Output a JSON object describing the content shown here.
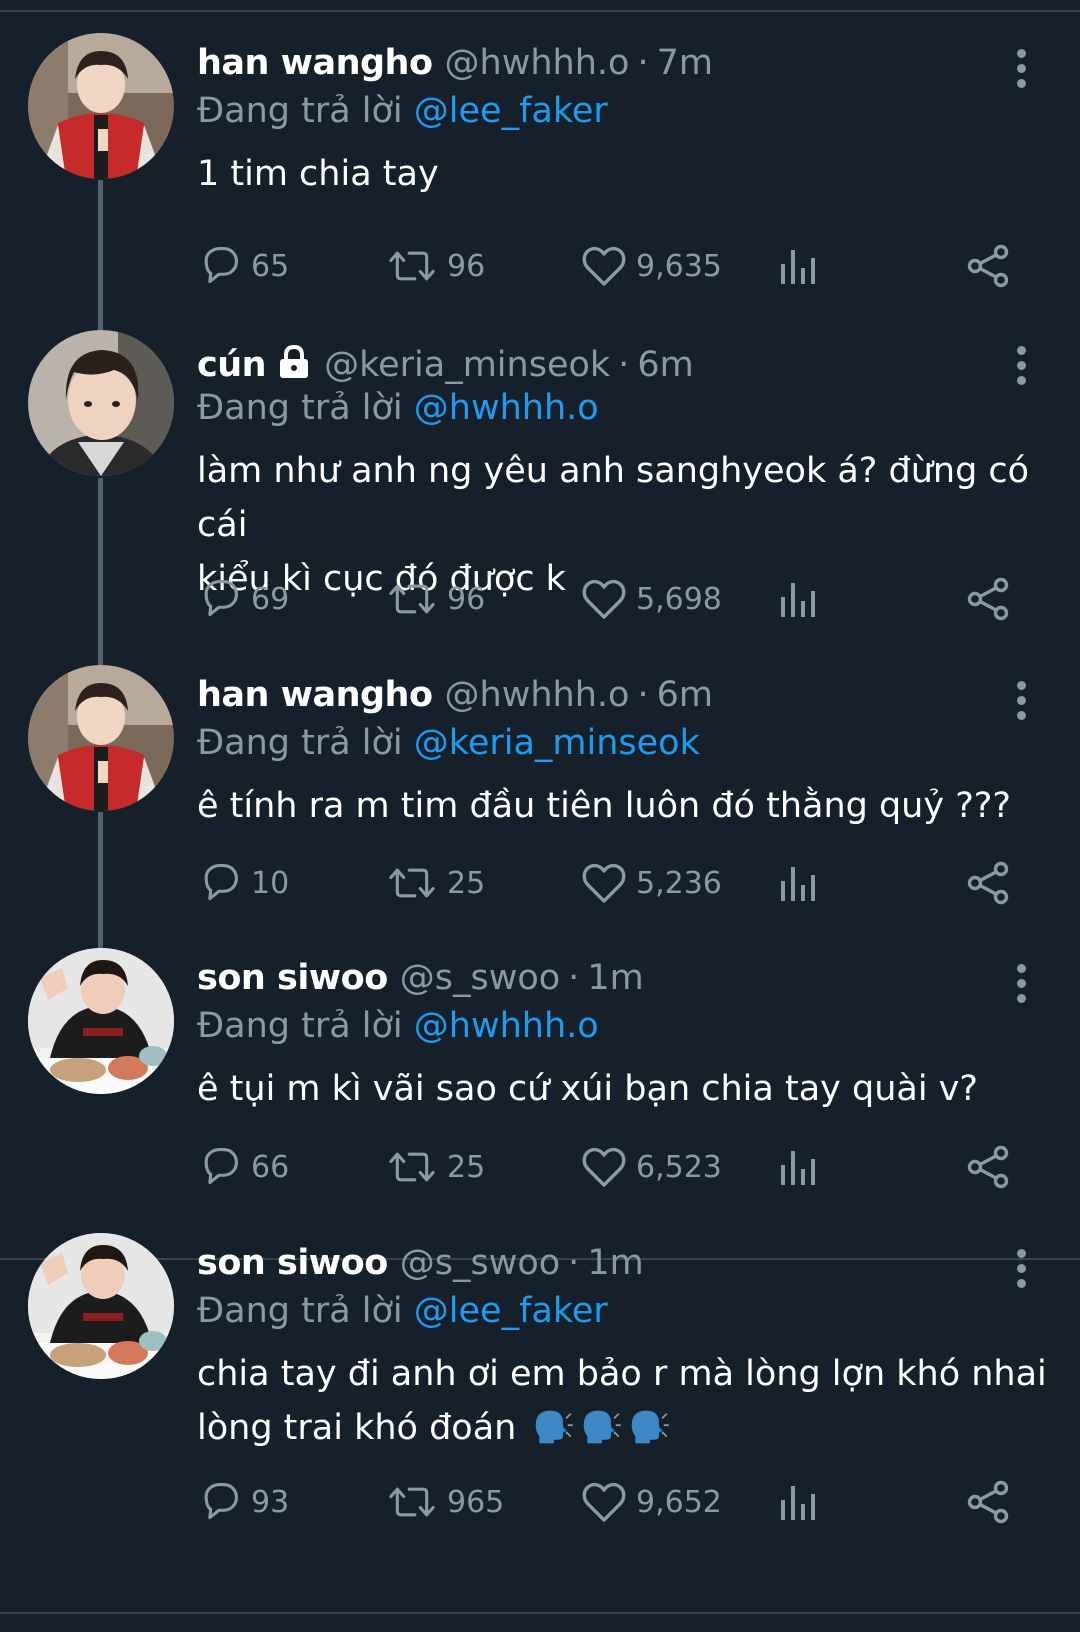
{
  "tweets": [
    {
      "name": "han wangho",
      "handle": "@hwhhh.o",
      "time": "7m",
      "reply_prefix": "Đang trả lời",
      "reply_to": "@lee_faker",
      "text": "1 tim chia tay",
      "replies": "65",
      "retweets": "96",
      "likes": "9,635"
    },
    {
      "name": "cún",
      "locked": true,
      "handle": "@keria_minseok",
      "time": "6m",
      "reply_prefix": "Đang trả lời",
      "reply_to": "@hwhhh.o",
      "text_line1": "làm như anh ng yêu anh sanghyeok á? đừng có cái",
      "text_line2": "kiểu kì cục đó được k",
      "replies": "69",
      "retweets": "96",
      "likes": "5,698"
    },
    {
      "name": "han wangho",
      "handle": "@hwhhh.o",
      "time": "6m",
      "reply_prefix": "Đang trả lời",
      "reply_to": "@keria_minseok",
      "text": "ê tính ra m tim đầu tiên luôn đó thằng quỷ ???",
      "replies": "10",
      "retweets": "25",
      "likes": "5,236"
    },
    {
      "name": "son siwoo",
      "handle": "@s_swoo",
      "time": "1m",
      "reply_prefix": "Đang trả lời",
      "reply_to": "@hwhhh.o",
      "text": "ê tụi m kì vãi sao cứ xúi bạn chia tay quài v?",
      "replies": "66",
      "retweets": "25",
      "likes": "6,523"
    },
    {
      "name": "son siwoo",
      "handle": "@s_swoo",
      "time": "1m",
      "reply_prefix": "Đang trả lời",
      "reply_to": "@lee_faker",
      "text_line1": "chia tay đi anh ơi em bảo r mà lòng lợn khó nhai",
      "text_line2": "lòng trai khó đoán",
      "text_emoji": "speaking-head-emoji x3",
      "replies": "93",
      "retweets": "965",
      "likes": "9,652"
    }
  ],
  "separator": "·",
  "colors": {
    "background": "#15202b",
    "divider": "#38444d",
    "muted_text": "#8b98a5",
    "mention": "#1d9bf0",
    "thread_line": "#536471"
  },
  "icons": [
    "reply-icon",
    "retweet-icon",
    "like-icon",
    "views-icon",
    "share-icon",
    "more-icon",
    "lock-icon"
  ]
}
